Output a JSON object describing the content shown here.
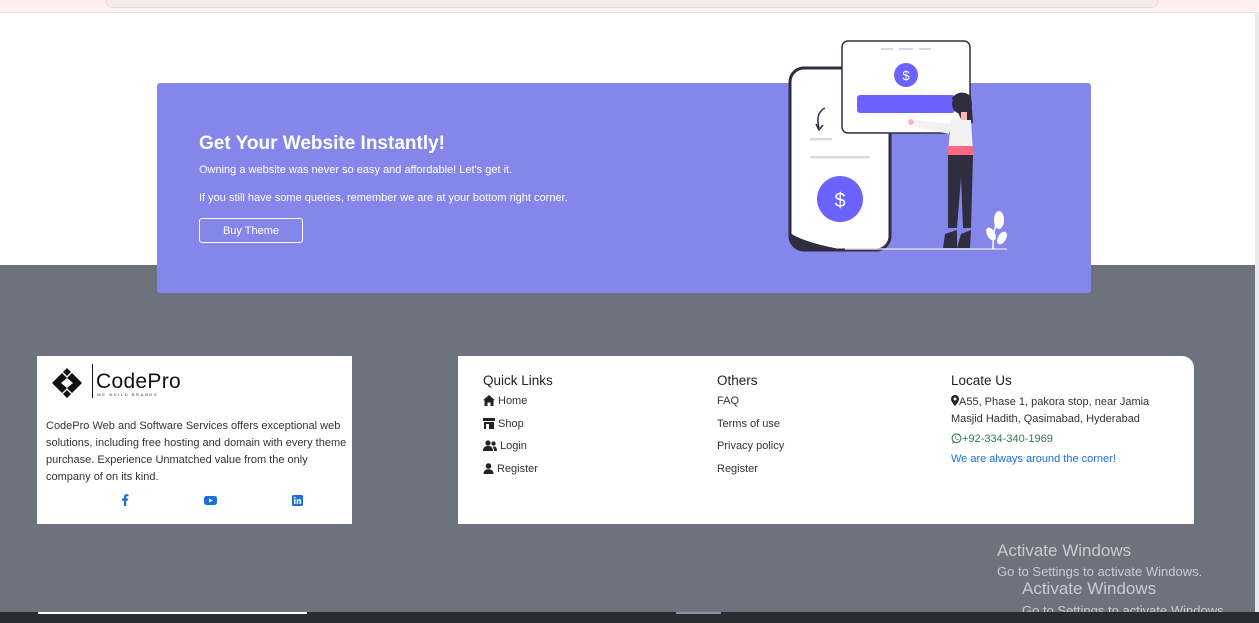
{
  "banner": {
    "title": "Get Your Website Instantly!",
    "line1": "Owning a website was never so easy and affordable! Let's get it.",
    "line2": "If you still have some queries, remember we are at your bottom right corner.",
    "button_label": "Buy Theme",
    "illustration_currency_symbol": "$"
  },
  "brand": {
    "name": "CodePro",
    "tagline": "WE BUILD BRANDS",
    "description": "CodePro Web and Software Services offers exceptional web solutions, including free hosting and domain with every theme purchase. Experience Unmatched value from the only company of on its kind.",
    "social": [
      {
        "name": "facebook-icon"
      },
      {
        "name": "youtube-icon"
      },
      {
        "name": "linkedin-icon"
      }
    ]
  },
  "quick_links": {
    "title": "Quick Links",
    "items": [
      {
        "label": "Home",
        "icon": "home-icon"
      },
      {
        "label": "Shop",
        "icon": "shop-icon"
      },
      {
        "label": "Login",
        "icon": "users-icon"
      },
      {
        "label": "Register",
        "icon": "user-icon"
      }
    ]
  },
  "others": {
    "title": "Others",
    "items": [
      {
        "label": "FAQ"
      },
      {
        "label": "Terms of use"
      },
      {
        "label": "Privacy policy"
      },
      {
        "label": "Register"
      }
    ]
  },
  "locate": {
    "title": "Locate Us",
    "address": "A55, Phase 1, pakora stop, near Jamia Masjid Hadith, Qasimabad, Hyderabad",
    "phone": "+92-334-340-1969",
    "tagline": "We are always around the corner!"
  },
  "watermark": {
    "title": "Activate Windows",
    "subtitle": "Go to Settings to activate Windows."
  },
  "colors": {
    "banner_bg": "#8586e9",
    "footer_bg": "#6c737c",
    "accent_purple": "#6c63ff",
    "link_blue": "#1a6fe0",
    "phone_green": "#2e7d4f"
  }
}
